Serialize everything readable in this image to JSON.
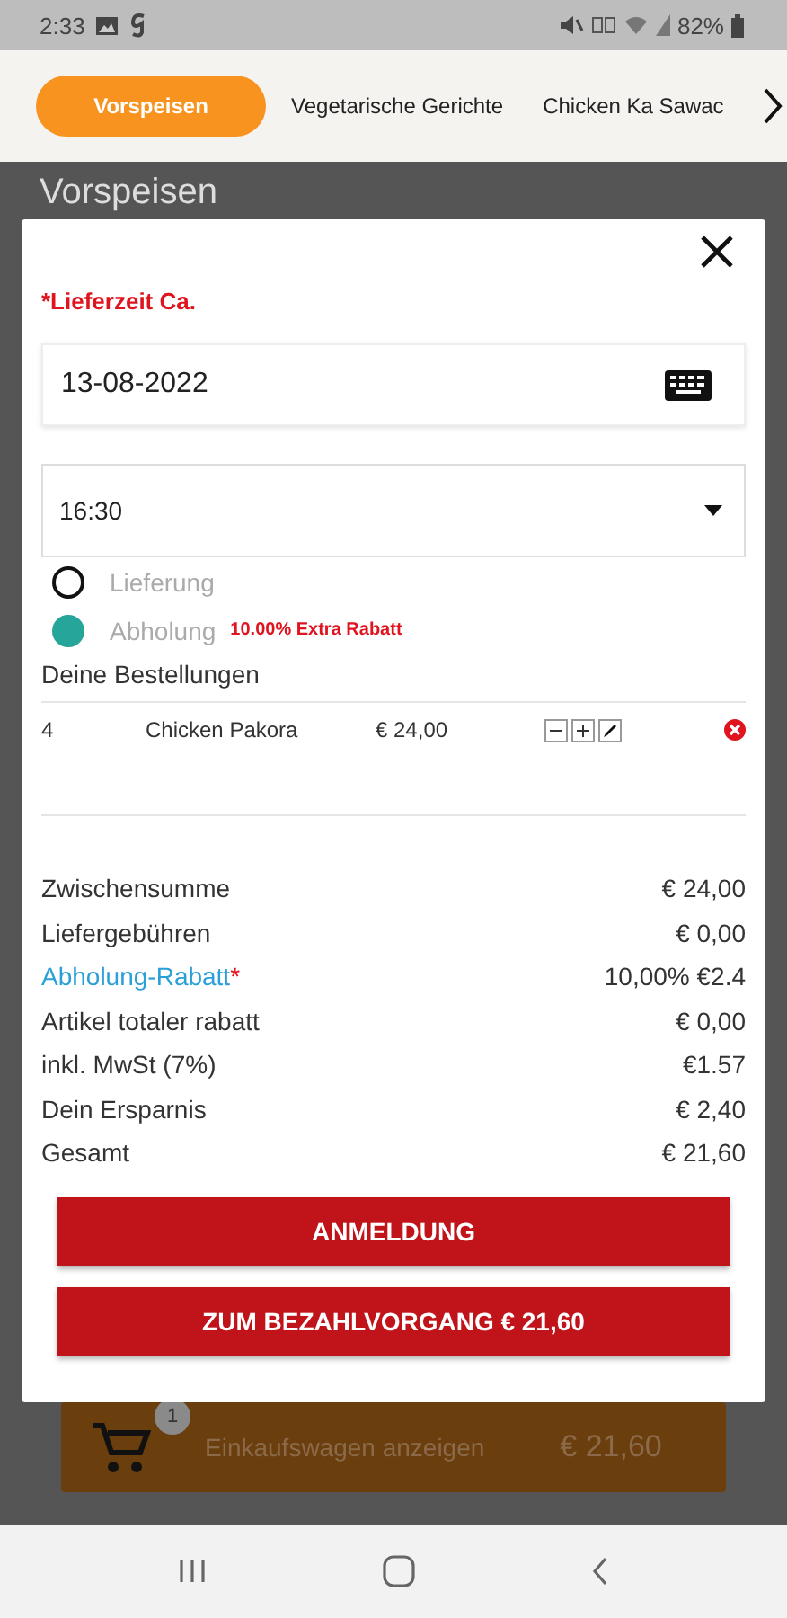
{
  "status_bar": {
    "time": "2:33",
    "battery": "82%"
  },
  "tabs": [
    {
      "label": "Vorspeisen",
      "selected": true
    },
    {
      "label": "Vegetarische Gerichte",
      "selected": false
    },
    {
      "label": "Chicken Ka Sawac",
      "selected": false
    }
  ],
  "background": {
    "heading": "Vorspeisen",
    "cart": {
      "badge": "1",
      "label": "Einkaufswagen anzeigen",
      "total": "€ 21,60"
    }
  },
  "dialog": {
    "delivery_time_label": "*Lieferzeit Ca.",
    "date": "13-08-2022",
    "time": "16:30",
    "options": [
      {
        "label": "Lieferung",
        "selected": false
      },
      {
        "label": "Abholung",
        "selected": true,
        "note": "10.00% Extra Rabatt"
      }
    ],
    "orders_heading": "Deine Bestellungen",
    "orders": [
      {
        "quantity": "4",
        "name": "Chicken Pakora",
        "price": "€ 24,00"
      }
    ],
    "summary": [
      {
        "kind": "plain",
        "label": "Zwischensumme",
        "value": "€ 24,00"
      },
      {
        "kind": "plain",
        "label": "Liefergebühren",
        "value": "€ 0,00"
      },
      {
        "kind": "link",
        "label": "Abholung-Rabatt",
        "mark": "*",
        "value": "10,00% €2.4"
      },
      {
        "kind": "plain",
        "label": "Artikel totaler rabatt",
        "value": "€ 0,00"
      },
      {
        "kind": "plain",
        "label": "inkl. MwSt (7%)",
        "value": "€1.57"
      },
      {
        "kind": "plain",
        "label": "Dein Ersparnis",
        "value": "€ 2,40"
      },
      {
        "kind": "plain",
        "label": "Gesamt",
        "value": "€ 21,60"
      }
    ],
    "buttons": [
      "ANMELDUNG",
      "ZUM BEZAHLVORGANG € 21,60"
    ]
  }
}
